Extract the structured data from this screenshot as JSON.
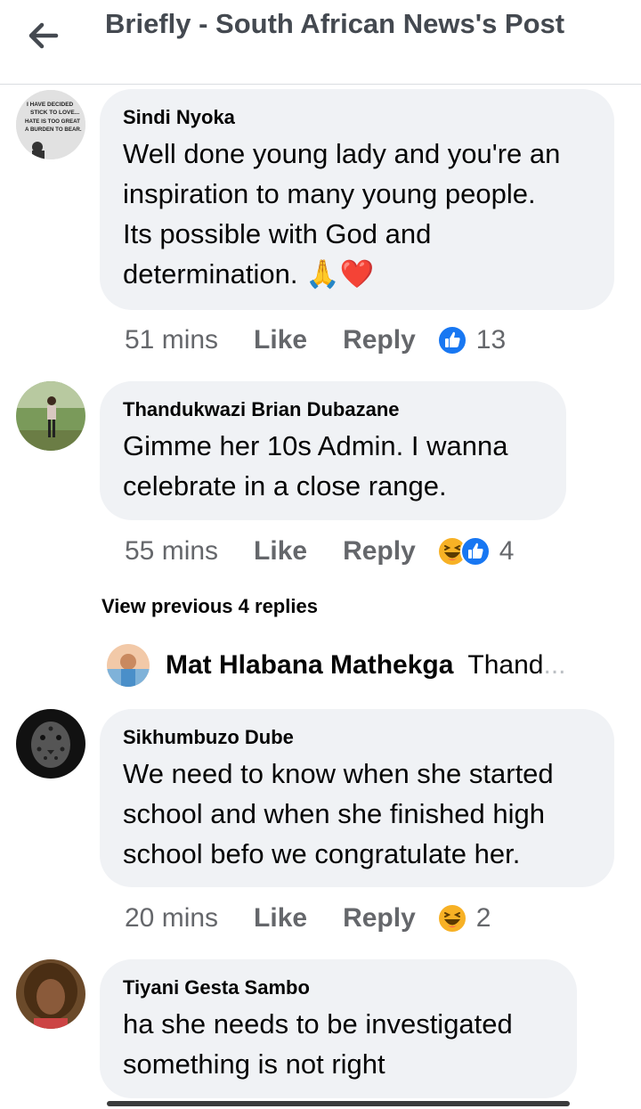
{
  "header": {
    "title": "Briefly - South African News's Post",
    "back_icon": "arrow-left-icon"
  },
  "comments": [
    {
      "author": "Sindi Nyoka",
      "avatar_text": [
        "I HAVE DECIDED",
        "STICK TO LOVE...",
        "HATE IS TOO GREAT",
        "A BURDEN TO BEAR."
      ],
      "lines": [
        "Well done young lady and you're an",
        "inspiration to many young people.",
        "Its possible with God and",
        "determination. 🙏❤️"
      ],
      "time": "51 mins",
      "like": "Like",
      "reply": "Reply",
      "reactions": [
        "like-reaction-icon"
      ],
      "reaction_count": "13"
    },
    {
      "author": "Thandukwazi Brian Dubazane",
      "lines": [
        "Gimme her 10s Admin. I wanna",
        "celebrate in a close range."
      ],
      "time": "55 mins",
      "like": "Like",
      "reply": "Reply",
      "reactions": [
        "haha-reaction-icon",
        "like-reaction-icon"
      ],
      "reaction_count": "4"
    },
    {
      "author": "Sikhumbuzo Dube",
      "lines": [
        "We need to know when she started",
        "school and when she finished high",
        "school befo we congratulate her."
      ],
      "time": "20 mins",
      "like": "Like",
      "reply": "Reply",
      "reactions": [
        "haha-reaction-icon"
      ],
      "reaction_count": "2"
    },
    {
      "author": "Tiyani Gesta Sambo",
      "lines": [
        "ha she needs  to be investigated",
        "something is not right"
      ]
    }
  ],
  "view_previous": "View previous 4 replies",
  "reply_preview": {
    "name": "Mat Hlabana Mathekga",
    "snippet": "Thand",
    "ellipsis": "..."
  },
  "colors": {
    "bubble": "#f0f2f5",
    "meta_text": "#65676b",
    "like_blue": "#1877f2",
    "haha_yellow": "#f7b125"
  }
}
